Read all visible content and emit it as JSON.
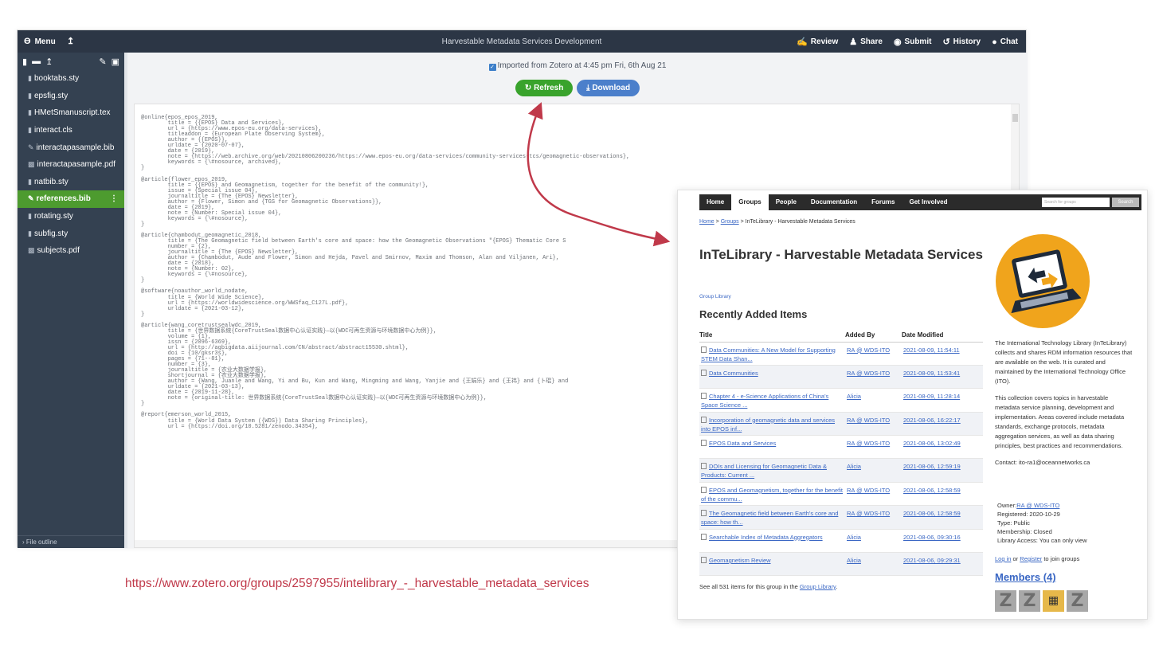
{
  "overleaf": {
    "menu_label": "Menu",
    "project_title": "Harvestable Metadata Services Development",
    "actions": [
      {
        "label": "Review",
        "icon": "review-icon"
      },
      {
        "label": "Share",
        "icon": "share-icon"
      },
      {
        "label": "Submit",
        "icon": "globe-icon"
      },
      {
        "label": "History",
        "icon": "history-icon"
      },
      {
        "label": "Chat",
        "icon": "chat-icon"
      }
    ],
    "files": [
      "booktabs.sty",
      "epsfig.sty",
      "HMetSmanuscript.tex",
      "interact.cls",
      "interactapasample.bib",
      "interactapasample.pdf",
      "natbib.sty",
      "references.bib",
      "rotating.sty",
      "subfig.sty",
      "subjects.pdf"
    ],
    "active_file": "references.bib",
    "file_outline": "File outline",
    "imported_text": "Imported from Zotero at 4:45 pm Fri, 6th Aug 21",
    "refresh_label": "Refresh",
    "download_label": "Download",
    "code_lines": [
      "@online{epos_epos_2019,",
      "        title = {{EPOS} Data and Services},",
      "        url = {https://www.epos-eu.org/data-services},",
      "        titleaddon = {European Plate Observing System},",
      "        author = {{EPOS}},",
      "        urldate = {2020-07-07},",
      "        date = {2019},",
      "        note = {https://web.archive.org/web/20210806200236/https://www.epos-eu.org/data-services/community-services-tcs/geomagnetic-observations},",
      "        keywords = {\\#nosource, archived},",
      "}",
      "",
      "@article{flower_epos_2019,",
      "        title = {{EPOS} and Geomagnetism, together for the benefit of the community!},",
      "        issue = {Special issue 04},",
      "        journaltitle = {The {EPOS} Newsletter},",
      "        author = {Flower, Simon and {TGS for Geomagnetic Observations}},",
      "        date = {2019},",
      "        note = {Number: Special issue 04},",
      "        keywords = {\\#nosource},",
      "}",
      "",
      "@article{chambodut_geomagnetic_2018,",
      "        title = {The Geomagnetic field between Earth's core and space: how the Geomagnetic Observations \"{EPOS} Thematic Core S",
      "        number = {2},",
      "        journaltitle = {The {EPOS} Newsletter},",
      "        author = {Chambodut, Aude and Flower, Simon and Hejda, Pavel and Smirnov, Maxim and Thomson, Alan and Viljanen, Ari},",
      "        date = {2018},",
      "        note = {Number: 02},",
      "        keywords = {\\#nosource},",
      "}",
      "",
      "@software{noauthor_world_nodate,",
      "        title = {World Wide Science},",
      "        url = {https://worldwidescience.org/WWSfaq_C127L.pdf},",
      "        urldate = {2021-03-12},",
      "}",
      "",
      "@article{wang_coretrustsealwdc_2019,",
      "        title = {世界数据系统{CoreTrustSeal数据中心认证实践}—以{WDC可再生资源与环境数据中心为例}},",
      "        volume = {1},",
      "        issn = {2096-6369},",
      "        url = {http://agbigdata.aiijournal.com/CN/abstract/abstract15530.shtml},",
      "        doi = {10/gksr3s},",
      "        pages = {71--81},",
      "        number = {3},",
      "        journaltitle = {农业大数据学报},",
      "        shortjournal = {农业大数据学报},",
      "        author = {Wang, Juanle and Wang, Yi and Bu, Kun and Wang, Mingming and Wang, Yanjie and {王娟乐} and {王祎} and {卜琨} and",
      "        urldate = {2021-03-13},",
      "        date = {2019-11-28},",
      "        note = {original-title: 世界数据系统{CoreTrustSeal数据中心认证实践}—以{WDC可再生资源与环境数据中心为例}},",
      "}",
      "",
      "@report{emerson_world_2015,",
      "        title = {World Data System ({WDS}) Data Sharing Principles},",
      "        url = {https://doi.org/10.5281/zenodo.34354},"
    ]
  },
  "zotero": {
    "nav_tabs": [
      "Home",
      "Groups",
      "People",
      "Documentation",
      "Forums",
      "Get Involved"
    ],
    "active_tab": "Groups",
    "search_placeholder": "Search for groups",
    "search_button": "Search",
    "breadcrumb": {
      "home": "Home",
      "sep1": ">",
      "groups": "Groups",
      "sep2": ">",
      "current": "InTeLibrary - Harvestable Metadata Services"
    },
    "group_title": "InTeLibrary - Harvestable Metadata Services",
    "group_library_link": "Group Library",
    "recent_heading": "Recently Added Items",
    "table_headers": {
      "title": "Title",
      "added_by": "Added By",
      "date": "Date Modified"
    },
    "items": [
      {
        "title": "Data Communities: A New Model for Supporting STEM Data Shan...",
        "by": "RA @ WDS-ITO",
        "date": "2021-08-09, 11:54:11"
      },
      {
        "title": "Data Communities",
        "by": "RA @ WDS-ITO",
        "date": "2021-08-09, 11:53:41"
      },
      {
        "title": "Chapter 4 - e-Science Applications of China's Space Science ...",
        "by": "Alicia",
        "date": "2021-08-09, 11:28:14"
      },
      {
        "title": "Incorporation of geomagnetic data and services into EPOS inf...",
        "by": "RA @ WDS-ITO",
        "date": "2021-08-06, 16:22:17"
      },
      {
        "title": "EPOS Data and Services",
        "by": "RA @ WDS-ITO",
        "date": "2021-08-06, 13:02:49"
      },
      {
        "title": "DOIs and Licensing for Geomagnetic Data & Products: Current ...",
        "by": "Alicia",
        "date": "2021-08-06, 12:59:19"
      },
      {
        "title": "EPOS and Geomagnetism, together for the benefit of the commu...",
        "by": "RA @ WDS-ITO",
        "date": "2021-08-06, 12:58:59"
      },
      {
        "title": "The Geomagnetic field between Earth's core and space: how th...",
        "by": "RA @ WDS-ITO",
        "date": "2021-08-06, 12:58:59"
      },
      {
        "title": "Searchable Index of Metadata Aggregators",
        "by": "Alicia",
        "date": "2021-08-06, 09:30:16"
      },
      {
        "title": "Geomagnetism Review",
        "by": "Alicia",
        "date": "2021-08-06, 09:29:31"
      }
    ],
    "see_all_prefix": "See all 531 items for this group in the",
    "see_all_link": "Group Library",
    "see_all_suffix": ".",
    "description": [
      "The International Technology Library (InTeLibrary) collects and shares RDM information resources that are available on the web. It is curated and maintained by the International Technology Office (ITO).",
      "This collection covers topics in harvestable metadata service planning, development and implementation. Areas covered include metadata standards, exchange protocols, metadata aggregation services, as well as data sharing principles, best practices and recommendations.",
      "Contact: ito-ra1@oceannetworks.ca"
    ],
    "owner_label": "Owner:",
    "owner_link": "RA @ WDS-ITO",
    "registered": "Registered: 2020-10-29",
    "type": "Type: Public",
    "membership": "Membership: Closed",
    "library_access": "Library Access: You can only view",
    "login_link": "Log in",
    "login_or": "or",
    "register_link": "Register",
    "login_suffix": "to join groups",
    "members_heading": "Members (4)"
  },
  "url_caption": "https://www.zotero.org/groups/2597955/intelibrary_-_harvestable_metadata_services",
  "colors": {
    "arrow": "#c0394a",
    "green": "#39a32c",
    "blue": "#4b7fcb",
    "logo_circle": "#f0a41c"
  }
}
